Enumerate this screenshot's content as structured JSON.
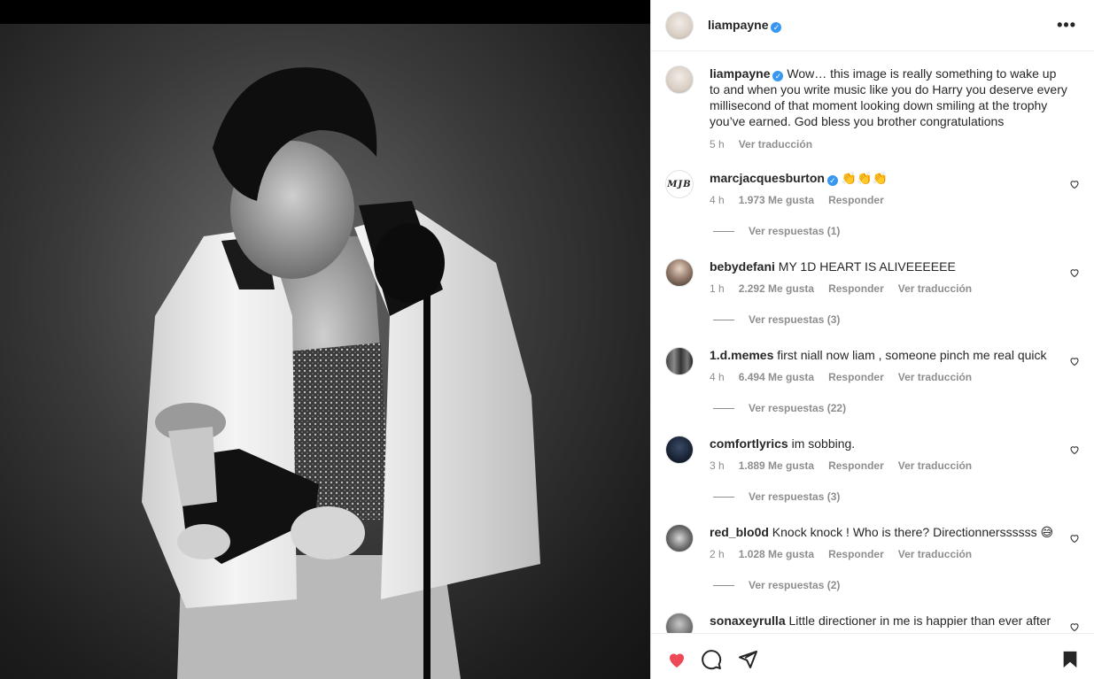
{
  "post": {
    "username": "liampayne",
    "caption": "Wow… this image is really something to wake up to and when you write music like you do Harry you deserve every millisecond of that moment looking down smiling at the trophy you’ve earned. God bless you brother congratulations",
    "caption_time": "5 h",
    "caption_translate": "Ver traducción"
  },
  "comments": [
    {
      "username": "marcjacquesburton",
      "verified": true,
      "text": "👏👏👏",
      "time": "4 h",
      "likes": "1.973 Me gusta",
      "reply": "Responder",
      "translate": "",
      "replies": "Ver respuestas (1)",
      "avatar_text": "MJB"
    },
    {
      "username": "bebydefani",
      "verified": false,
      "text": "MY 1D HEART IS ALIVEEEEEE",
      "time": "1 h",
      "likes": "2.292 Me gusta",
      "reply": "Responder",
      "translate": "Ver traducción",
      "replies": "Ver respuestas (3)"
    },
    {
      "username": "1.d.memes",
      "verified": false,
      "text": "first niall now liam , someone pinch me real quick",
      "time": "4 h",
      "likes": "6.494 Me gusta",
      "reply": "Responder",
      "translate": "Ver traducción",
      "replies": "Ver respuestas (22)"
    },
    {
      "username": "comfortlyrics",
      "verified": false,
      "text": "im sobbing.",
      "time": "3 h",
      "likes": "1.889 Me gusta",
      "reply": "Responder",
      "translate": "Ver traducción",
      "replies": "Ver respuestas (3)"
    },
    {
      "username": "red_blo0d",
      "verified": false,
      "text": "Knock knock ! Who is there? Directionnerssssss 😅",
      "time": "2 h",
      "likes": "1.028 Me gusta",
      "reply": "Responder",
      "translate": "Ver traducción",
      "replies": "Ver respuestas (2)"
    },
    {
      "username": "sonaxeyrulla",
      "verified": false,
      "text": "Little directioner in me is happier than ever after",
      "time": "",
      "likes": "",
      "reply": "",
      "translate": "",
      "replies": ""
    }
  ],
  "icons": {
    "more": "more-options-icon",
    "like": "heart-filled-icon",
    "comment": "comment-icon",
    "share": "share-icon",
    "save": "bookmark-icon",
    "comment_like": "heart-outline-icon"
  },
  "colors": {
    "like_active": "#ed4956",
    "verified": "#3897f0",
    "muted_text": "#8e8e8e"
  }
}
